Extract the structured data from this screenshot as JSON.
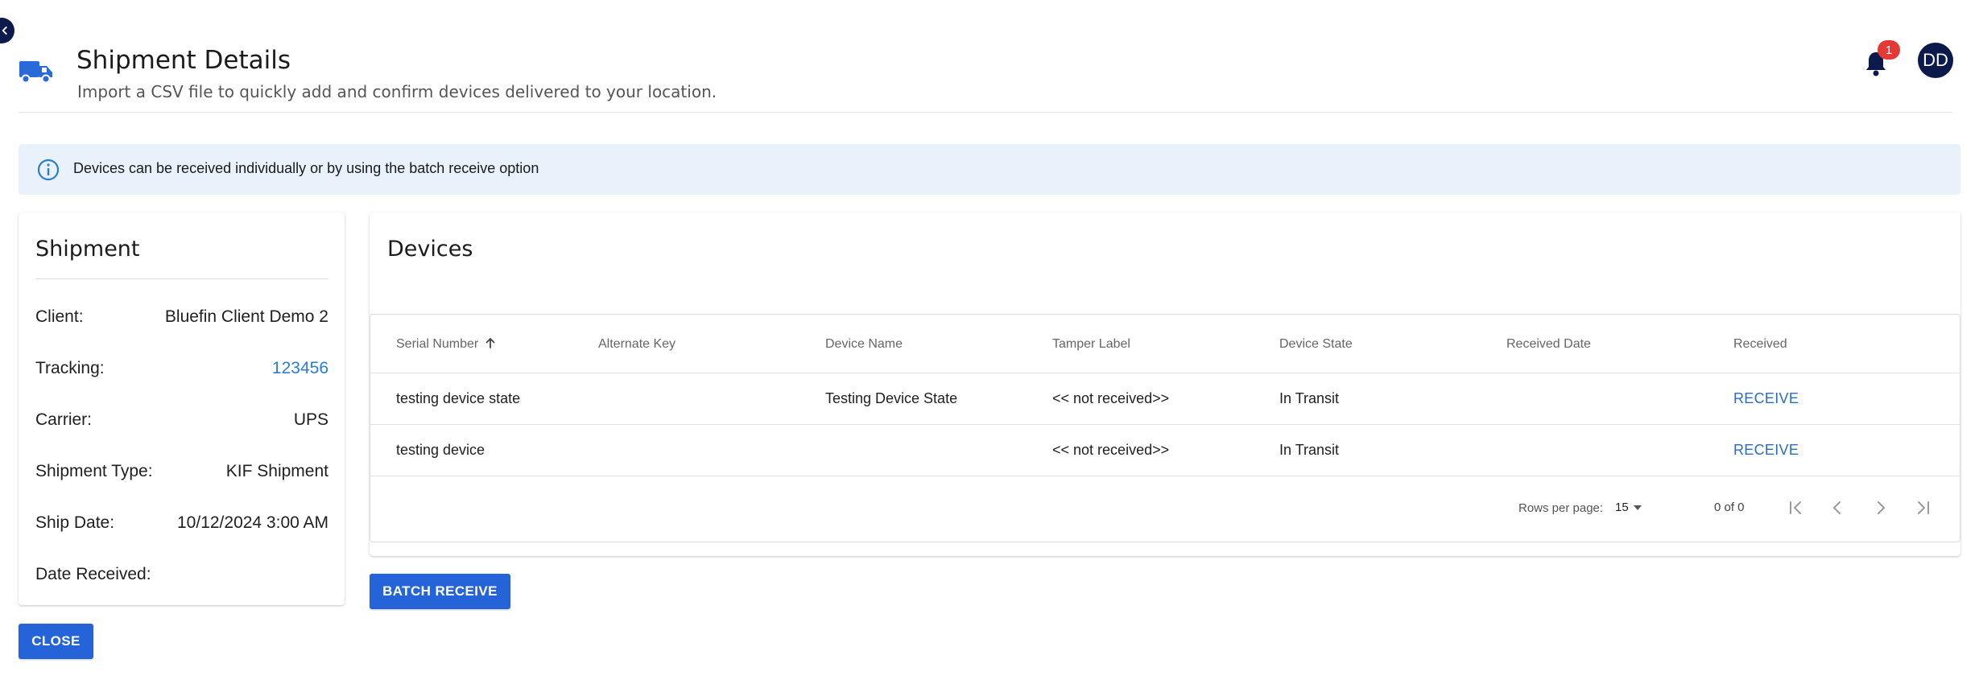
{
  "header": {
    "title": "Shipment Details",
    "subtitle": "Import a CSV file to quickly add and confirm devices delivered to your location.",
    "notification_count": "1",
    "avatar_initials": "DD"
  },
  "alert": {
    "text": "Devices can be received individually or by using the batch receive option"
  },
  "shipment": {
    "title": "Shipment",
    "fields": [
      {
        "label": "Client:",
        "value": "Bluefin Client Demo 2"
      },
      {
        "label": "Tracking:",
        "value": "123456"
      },
      {
        "label": "Carrier:",
        "value": "UPS"
      },
      {
        "label": "Shipment Type:",
        "value": "KIF Shipment"
      },
      {
        "label": "Ship Date:",
        "value": "10/12/2024 3:00 AM"
      },
      {
        "label": "Date Received:",
        "value": ""
      }
    ]
  },
  "devices": {
    "title": "Devices",
    "columns": [
      "Serial Number",
      "Alternate Key",
      "Device Name",
      "Tamper Label",
      "Device State",
      "Received Date",
      "Received"
    ],
    "rows": [
      {
        "serial": "testing device state",
        "alt_key": "",
        "name": "Testing Device State",
        "tamper": "<< not received>>",
        "state": "In Transit",
        "received_date": "",
        "action": "RECEIVE"
      },
      {
        "serial": "testing device",
        "alt_key": "",
        "name": "",
        "tamper": "<< not received>>",
        "state": "In Transit",
        "received_date": "",
        "action": "RECEIVE"
      }
    ],
    "pagination": {
      "rows_per_page_label": "Rows per page:",
      "rows_per_page_value": "15",
      "range": "0 of 0"
    }
  },
  "buttons": {
    "batch_receive": "BATCH RECEIVE",
    "close": "CLOSE"
  },
  "colors": {
    "primary": "#2563d8",
    "link": "#2a7dd1",
    "alert_bg": "#e9f1fb",
    "badge": "#e53935",
    "avatar": "#0b1a4a"
  }
}
